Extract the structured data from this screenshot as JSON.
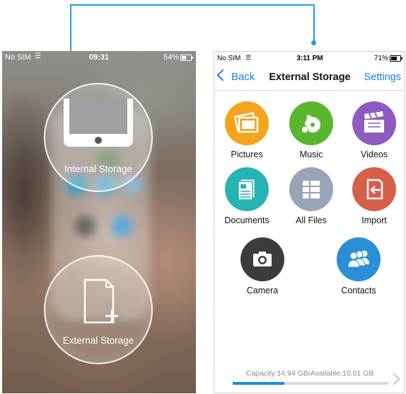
{
  "left_phone": {
    "status": {
      "carrier": "No SIM",
      "time": "09:31",
      "battery": "54%",
      "battery_level": 0.54
    },
    "internal_label": "Internal Storage",
    "external_label": "External Storage"
  },
  "right_phone": {
    "status": {
      "carrier": "No SIM",
      "time": "3:11 PM",
      "battery": "71%",
      "battery_level": 0.71
    },
    "nav": {
      "back": "Back",
      "title": "External Storage",
      "settings": "Settings"
    },
    "tiles": [
      {
        "label": "Pictures",
        "icon": "pictures-icon",
        "color": "#f3a41c"
      },
      {
        "label": "Music",
        "icon": "music-icon",
        "color": "#5ab62d"
      },
      {
        "label": "Videos",
        "icon": "videos-icon",
        "color": "#8d5bc1"
      },
      {
        "label": "Documents",
        "icon": "documents-icon",
        "color": "#27b3b3"
      },
      {
        "label": "All Files",
        "icon": "all-files-icon",
        "color": "#97a5b6"
      },
      {
        "label": "Import",
        "icon": "import-icon",
        "color": "#d65f4a"
      },
      {
        "label": "Camera",
        "icon": "camera-icon",
        "color": "#3c3c3c"
      },
      {
        "label": "Contacts",
        "icon": "contacts-icon",
        "color": "#2b8fd6"
      }
    ],
    "capacity": "Capacity:14.94 GB/Available:10.01 GB",
    "capacity_used_fraction": 0.33
  },
  "colors": {
    "accent": "#1d7cf2",
    "connector": "#1a9fe0"
  }
}
